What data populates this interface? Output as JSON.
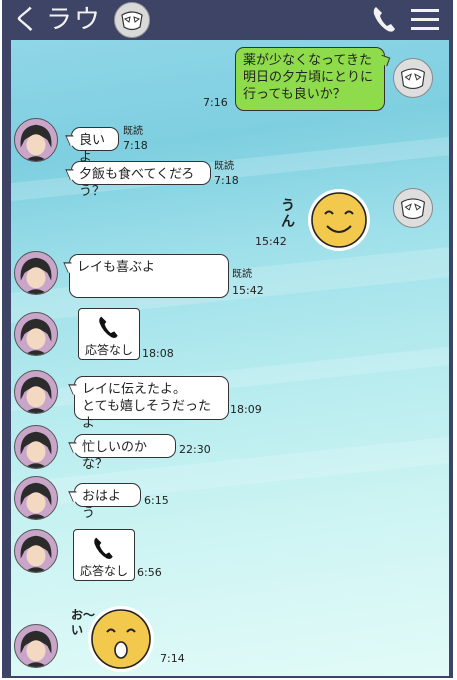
{
  "header": {
    "back_label": "く",
    "title": "ラウ",
    "phone_icon": "phone-icon",
    "menu_icon": "hamburger-menu-icon"
  },
  "messages": [
    {
      "id": "m1",
      "from": "me",
      "text": "薬が少なくなってきた\n明日の夕方頃にとりに\n行っても良いか？",
      "time": "7:16"
    },
    {
      "id": "m2",
      "from": "them",
      "text": "良いよ",
      "read": "既読",
      "time": "7:18"
    },
    {
      "id": "m3",
      "from": "them",
      "text": "夕飯も食べてくだろう？",
      "read": "既読",
      "time": "7:18"
    },
    {
      "id": "m4",
      "from": "me",
      "sticker": "smile-sticker",
      "sticker_text": "うん",
      "time": "15:42"
    },
    {
      "id": "m5",
      "from": "them",
      "text": "レイも喜ぶよ",
      "read": "既読",
      "time": "15:42"
    },
    {
      "id": "m6",
      "from": "them",
      "call": "応答なし",
      "time": "18:08"
    },
    {
      "id": "m7",
      "from": "them",
      "text": "レイに伝えたよ。\nとても嬉しそうだったよ",
      "time": "18:09"
    },
    {
      "id": "m8",
      "from": "them",
      "text": "忙しいのかな？",
      "time": "22:30"
    },
    {
      "id": "m9",
      "from": "them",
      "text": "おはよう",
      "time": "6:15"
    },
    {
      "id": "m10",
      "from": "them",
      "call": "応答なし",
      "time": "6:56"
    },
    {
      "id": "m11",
      "from": "them",
      "sticker": "shout-sticker",
      "sticker_text": "お〜い",
      "time": "7:14"
    }
  ],
  "colors": {
    "header_bg": "#3d4466",
    "my_bubble": "#8edc4c",
    "their_bubble": "#ffffff",
    "sticker_face": "#f2c94c"
  }
}
